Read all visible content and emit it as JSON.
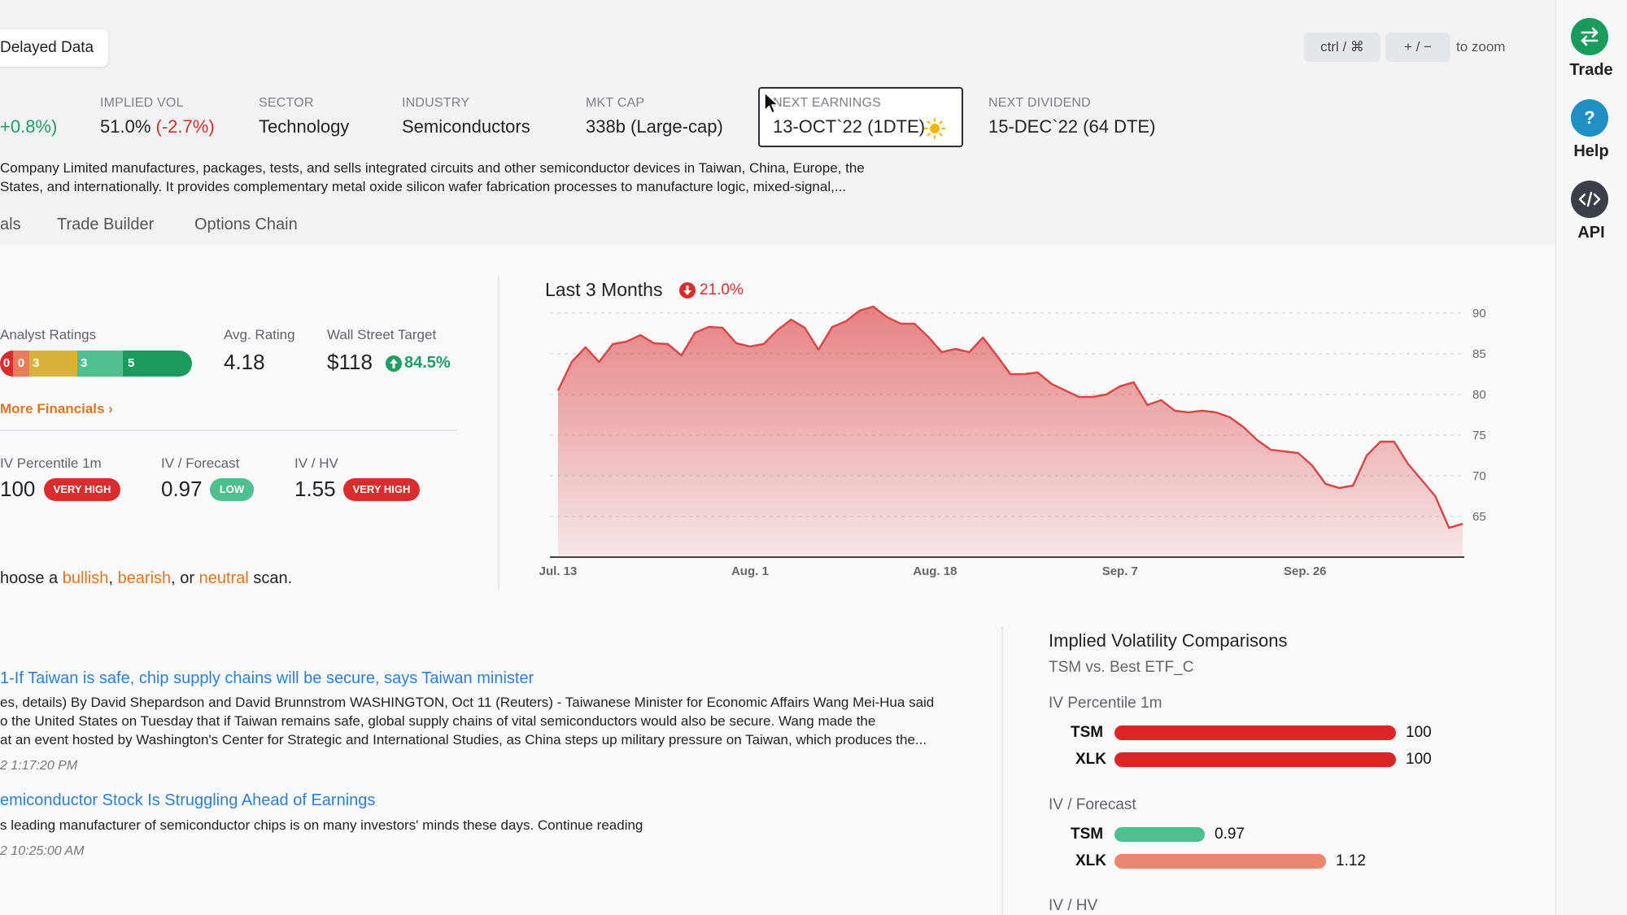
{
  "header": {
    "delayed": "Delayed Data",
    "kbd_ctrl": "ctrl / ⌘",
    "kbd_plusminus": "+ / −",
    "zoom_text": "to zoom"
  },
  "stats": {
    "price_change": "+0.8%)",
    "implied_vol_label": "IMPLIED VOL",
    "implied_vol_value": "51.0%",
    "implied_vol_change": "(-2.7%)",
    "sector_label": "SECTOR",
    "sector_value": "Technology",
    "industry_label": "INDUSTRY",
    "industry_value": "Semiconductors",
    "mktcap_label": "MKT CAP",
    "mktcap_value": "338b (Large-cap)",
    "earnings_label": "NEXT EARNINGS",
    "earnings_value": "13-OCT`22 (1DTE)",
    "dividend_label": "NEXT DIVIDEND",
    "dividend_value": "15-DEC`22 (64 DTE)"
  },
  "description": {
    "line1": "Company Limited manufactures, packages, tests, and sells integrated circuits and other semiconductor devices in Taiwan, China, Europe, the",
    "line2": "States, and internationally. It provides complementary metal oxide silicon wafer fabrication processes to manufacture logic, mixed-signal,..."
  },
  "tabs": [
    "als",
    "Trade Builder",
    "Options Chain"
  ],
  "financials": {
    "analyst_label": "Analyst Ratings",
    "ratings": [
      "0",
      "0",
      "3",
      "3",
      "5"
    ],
    "avg_label": "Avg. Rating",
    "avg_value": "4.18",
    "target_label": "Wall Street Target",
    "target_value": "$118",
    "target_change": "84.5%",
    "more_link": "More Financials",
    "ivp_label": "IV Percentile 1m",
    "ivp_value": "100",
    "ivp_badge": "VERY HIGH",
    "ivf_label": "IV / Forecast",
    "ivf_value": "0.97",
    "ivf_badge": "LOW",
    "ivhv_label": "IV / HV",
    "ivhv_value": "1.55",
    "ivhv_badge": "VERY HIGH",
    "scan_prefix": "hoose a ",
    "scan_bullish": "bullish",
    "scan_sep1": ", ",
    "scan_bearish": "bearish",
    "scan_sep2": ", or ",
    "scan_neutral": "neutral",
    "scan_suffix": " scan."
  },
  "chart_data": {
    "type": "area",
    "title": "Last 3 Months",
    "change": "21.0%",
    "x_ticks": [
      "Jul. 13",
      "Aug. 1",
      "Aug. 18",
      "Sep. 7",
      "Sep. 26"
    ],
    "y_ticks": [
      90,
      85,
      80,
      75,
      70,
      65
    ],
    "ylim": [
      60,
      91.5
    ],
    "color": "#e05a5a",
    "values": [
      80.5,
      84,
      85.8,
      84,
      86.2,
      86.5,
      87.3,
      86.3,
      86.2,
      84.8,
      87.6,
      88.3,
      88.2,
      86.3,
      85.9,
      86.2,
      87.9,
      89.2,
      88.2,
      85.5,
      88.3,
      89,
      90.3,
      90.8,
      89.5,
      88.7,
      88.7,
      87.1,
      85.2,
      85.6,
      85.2,
      87,
      84.8,
      82.5,
      82.5,
      82.7,
      81.3,
      80.5,
      79.7,
      79.7,
      80,
      81,
      81.5,
      78.7,
      79.3,
      78,
      77.8,
      78,
      77.8,
      77.2,
      76,
      74.4,
      73.2,
      73,
      72.8,
      71.3,
      69,
      68.5,
      68.8,
      72.5,
      74.2,
      74.2,
      71.5,
      69.5,
      67.5,
      63.6,
      64.1
    ]
  },
  "news": [
    {
      "title": "1-If Taiwan is safe, chip supply chains will be secure, says Taiwan minister",
      "body1": "es, details) By David Shepardson and David Brunnstrom WASHINGTON, Oct 11 (Reuters) - Taiwanese Minister for Economic Affairs Wang Mei-Hua said",
      "body2": "o the United States on Tuesday that if Taiwan remains safe, global supply chains of vital semiconductors would also be secure. Wang made the",
      "body3": "at an event hosted by Washington's Center for Strategic and International Studies, as China steps up military pressure on Taiwan, which produces the...",
      "time": "2 1:17:20 PM"
    },
    {
      "title": "emiconductor Stock Is Struggling Ahead of Earnings",
      "body1": "s leading manufacturer of semiconductor chips is on many investors' minds these days. Continue reading",
      "time": "2 10:25:00 AM"
    }
  ],
  "iv_comparisons": {
    "title": "Implied Volatility Comparisons",
    "subtitle": "TSM vs. Best ETF_C",
    "groups": [
      {
        "label": "IV Percentile 1m",
        "rows": [
          {
            "ticker": "TSM",
            "value": "100",
            "fraction": 1.0,
            "color": "#dc2626"
          },
          {
            "ticker": "XLK",
            "value": "100",
            "fraction": 1.0,
            "color": "#dc2626"
          }
        ]
      },
      {
        "label": "IV / Forecast",
        "rows": [
          {
            "ticker": "TSM",
            "value": "0.97",
            "fraction": 0.32,
            "color": "#4fbf91"
          },
          {
            "ticker": "XLK",
            "value": "1.12",
            "fraction": 0.75,
            "color": "#ec8570"
          }
        ]
      },
      {
        "label": "IV / HV",
        "rows": []
      }
    ]
  },
  "rightbar": {
    "trade": "Trade",
    "help": "Help",
    "api": "API"
  }
}
